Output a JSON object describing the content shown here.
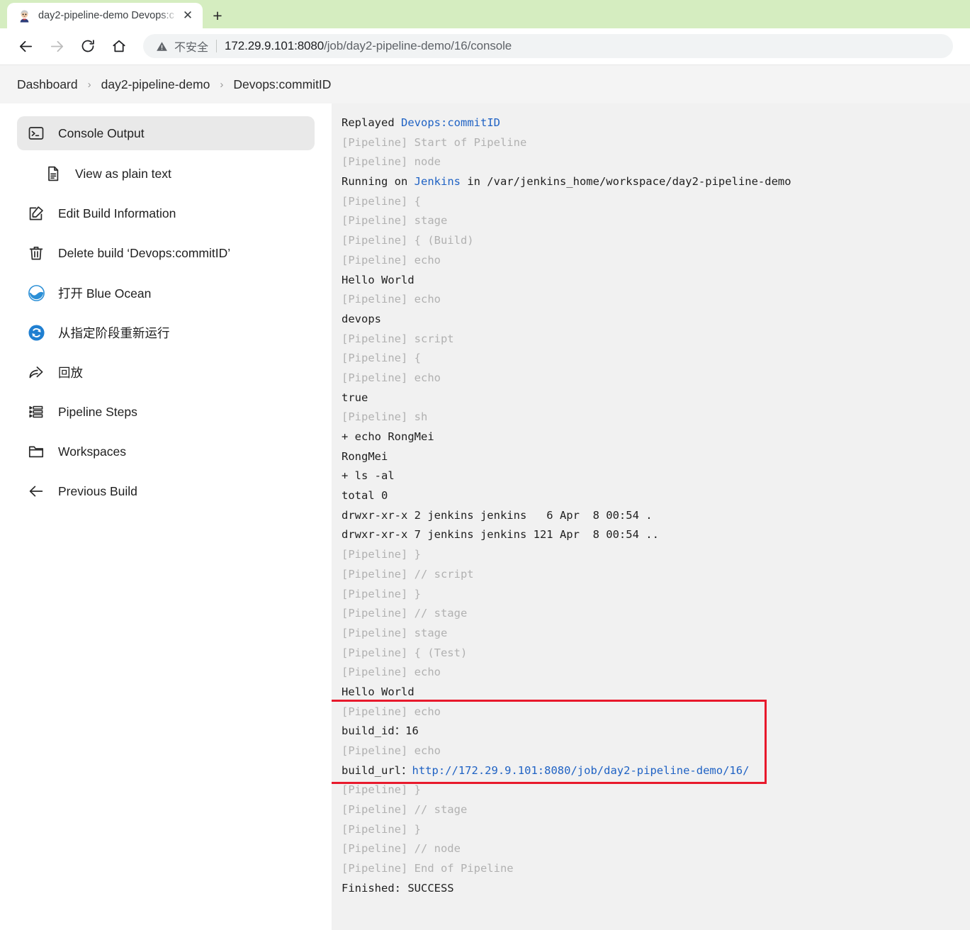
{
  "browser": {
    "tab": {
      "title": "day2-pipeline-demo Devops:c",
      "favicon": "jenkins-butler-icon",
      "close_label": "✕"
    },
    "newtab_label": "+",
    "nav": {
      "back": "←",
      "forward": "→",
      "reload": "⟳",
      "home": "⌂"
    },
    "omnibox": {
      "security_label": "不安全",
      "url": "172.29.9.101:8080/job/day2-pipeline-demo/16/console",
      "url_host": "172.29.9.101:8080",
      "url_path": "/job/day2-pipeline-demo/16/console"
    }
  },
  "breadcrumb": {
    "separator": "›",
    "items": [
      {
        "label": "Dashboard"
      },
      {
        "label": "day2-pipeline-demo"
      },
      {
        "label": "Devops:commitID"
      }
    ]
  },
  "sidebar": {
    "items": [
      {
        "label": "Console Output",
        "icon": "terminal-icon",
        "active": true,
        "sub": false
      },
      {
        "label": "View as plain text",
        "icon": "document-icon",
        "active": false,
        "sub": true
      },
      {
        "label": "Edit Build Information",
        "icon": "edit-pencil-icon",
        "active": false,
        "sub": false
      },
      {
        "label": "Delete build ‘Devops:commitID’",
        "icon": "trash-icon",
        "active": false,
        "sub": false
      },
      {
        "label": "打开 Blue Ocean",
        "icon": "blue-ocean-icon",
        "active": false,
        "sub": false
      },
      {
        "label": "从指定阶段重新运行",
        "icon": "restart-stage-icon",
        "active": false,
        "sub": false
      },
      {
        "label": "回放",
        "icon": "replay-arrow-icon",
        "active": false,
        "sub": false
      },
      {
        "label": "Pipeline Steps",
        "icon": "steps-list-icon",
        "active": false,
        "sub": false
      },
      {
        "label": "Workspaces",
        "icon": "folder-icon",
        "active": false,
        "sub": false
      },
      {
        "label": "Previous Build",
        "icon": "arrow-left-icon",
        "active": false,
        "sub": false
      }
    ]
  },
  "console": {
    "lines": [
      {
        "t": "Replayed ",
        "link": "Devops:commitID",
        "after": "",
        "style": "normal"
      },
      {
        "t": "[Pipeline] Start of Pipeline",
        "style": "pipe"
      },
      {
        "t": "[Pipeline] node",
        "style": "pipe"
      },
      {
        "t": "Running on ",
        "link": "Jenkins",
        "after": " in /var/jenkins_home/workspace/day2-pipeline-demo",
        "style": "normal"
      },
      {
        "t": "[Pipeline] {",
        "style": "pipe"
      },
      {
        "t": "[Pipeline] stage",
        "style": "pipe"
      },
      {
        "t": "[Pipeline] { (Build)",
        "style": "pipe"
      },
      {
        "t": "[Pipeline] echo",
        "style": "pipe"
      },
      {
        "t": "Hello World",
        "style": "normal"
      },
      {
        "t": "[Pipeline] echo",
        "style": "pipe"
      },
      {
        "t": "devops",
        "style": "normal"
      },
      {
        "t": "[Pipeline] script",
        "style": "pipe"
      },
      {
        "t": "[Pipeline] {",
        "style": "pipe"
      },
      {
        "t": "[Pipeline] echo",
        "style": "pipe"
      },
      {
        "t": "true",
        "style": "normal"
      },
      {
        "t": "[Pipeline] sh",
        "style": "pipe"
      },
      {
        "t": "+ echo RongMei",
        "style": "normal"
      },
      {
        "t": "RongMei",
        "style": "normal"
      },
      {
        "t": "+ ls -al",
        "style": "normal"
      },
      {
        "t": "total 0",
        "style": "normal"
      },
      {
        "t": "drwxr-xr-x 2 jenkins jenkins   6 Apr  8 00:54 .",
        "style": "normal"
      },
      {
        "t": "drwxr-xr-x 7 jenkins jenkins 121 Apr  8 00:54 ..",
        "style": "normal"
      },
      {
        "t": "[Pipeline] }",
        "style": "pipe"
      },
      {
        "t": "[Pipeline] // script",
        "style": "pipe"
      },
      {
        "t": "[Pipeline] }",
        "style": "pipe"
      },
      {
        "t": "[Pipeline] // stage",
        "style": "pipe"
      },
      {
        "t": "[Pipeline] stage",
        "style": "pipe"
      },
      {
        "t": "[Pipeline] { (Test)",
        "style": "pipe"
      },
      {
        "t": "[Pipeline] echo",
        "style": "pipe"
      },
      {
        "t": "Hello World",
        "style": "normal"
      },
      {
        "t": "[Pipeline] echo",
        "style": "pipe"
      },
      {
        "t": "build_id：16",
        "style": "normal"
      },
      {
        "t": "[Pipeline] echo",
        "style": "pipe"
      },
      {
        "t": "build_url：",
        "link": "http://172.29.9.101:8080/job/day2-pipeline-demo/16/",
        "after": "",
        "style": "normal"
      },
      {
        "t": "[Pipeline] }",
        "style": "pipe"
      },
      {
        "t": "[Pipeline] // stage",
        "style": "pipe"
      },
      {
        "t": "[Pipeline] }",
        "style": "pipe"
      },
      {
        "t": "[Pipeline] // node",
        "style": "pipe"
      },
      {
        "t": "[Pipeline] End of Pipeline",
        "style": "pipe"
      },
      {
        "t": "Finished: SUCCESS",
        "style": "normal"
      }
    ],
    "highlight": {
      "color": "#e8192c",
      "first_line_index": 30,
      "last_line_index": 33
    }
  },
  "colors": {
    "tabbar": "#d5edc0",
    "console_bg": "#f1f1f1",
    "link": "#1f62c4",
    "pipeline_gray": "#b1b1b1",
    "highlight_red": "#e8192c",
    "active_item": "#e9e9e9"
  }
}
